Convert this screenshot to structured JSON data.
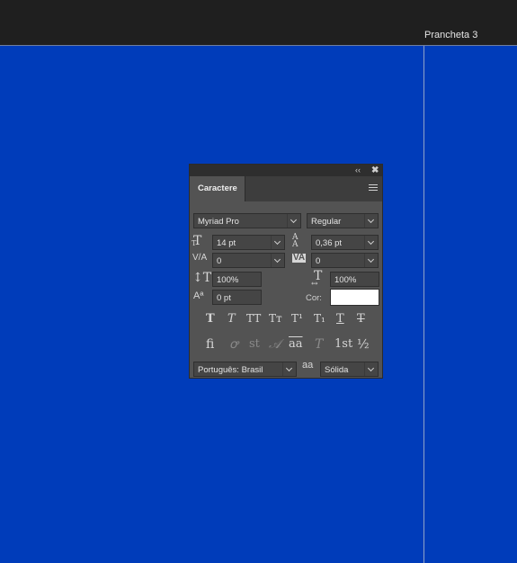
{
  "topbar": {
    "artboard_label": "Prancheta 3"
  },
  "panel": {
    "tab_label": "Caractere",
    "collapse_glyph": "‹‹",
    "close_glyph": "✖",
    "font_family": "Myriad Pro",
    "font_style": "Regular",
    "font_size": "14 pt",
    "leading": "0,36 pt",
    "kerning": "0",
    "tracking": "0",
    "vertical_scale": "100%",
    "horizontal_scale": "100%",
    "baseline_shift": "0 pt",
    "color_label": "Cor:",
    "color_value": "#ffffff",
    "language": "Português: Brasil",
    "antialias_icon_text": "aa",
    "antialias": "Sólida",
    "style_buttons": [
      {
        "name": "faux-bold-icon",
        "glyph": "T"
      },
      {
        "name": "faux-italic-icon",
        "glyph": "T"
      },
      {
        "name": "all-caps-icon",
        "glyph": "TT"
      },
      {
        "name": "small-caps-icon",
        "glyph": "Tт"
      },
      {
        "name": "superscript-icon",
        "glyph": "T¹"
      },
      {
        "name": "subscript-icon",
        "glyph": "T₁"
      },
      {
        "name": "underline-icon",
        "glyph": "T"
      },
      {
        "name": "strikethrough-icon",
        "glyph": "T"
      }
    ],
    "opentype_buttons": [
      {
        "name": "ligatures-icon",
        "glyph": "fi"
      },
      {
        "name": "discretionary-ligatures-icon",
        "glyph": "ꝍ"
      },
      {
        "name": "swash-icon",
        "glyph": "st"
      },
      {
        "name": "stylistic-alternates-icon",
        "glyph": "𝒜"
      },
      {
        "name": "titling-alternates-icon",
        "glyph": "aa"
      },
      {
        "name": "ordinals-icon",
        "glyph": "T"
      },
      {
        "name": "ordinal-st-icon",
        "glyph": "1st"
      },
      {
        "name": "fractions-icon",
        "glyph": "½"
      }
    ]
  },
  "colors": {
    "canvas": "#003cba",
    "panel": "#535353",
    "topbar": "#1f1f1f"
  }
}
